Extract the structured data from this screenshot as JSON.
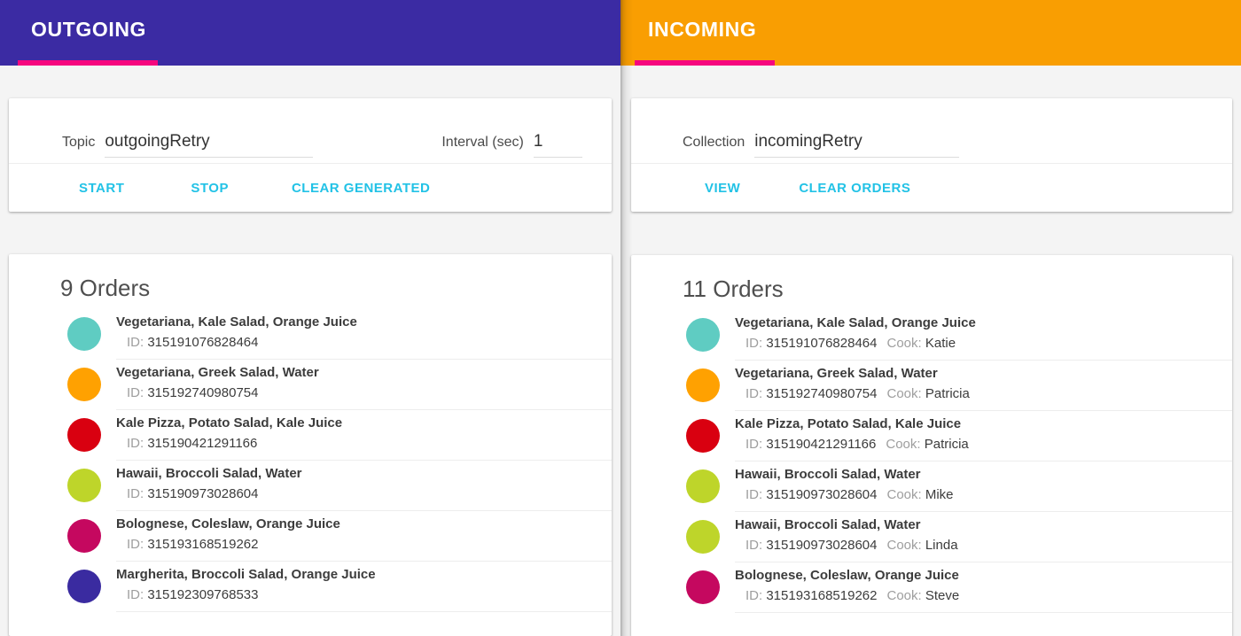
{
  "colors": {
    "outgoing_header": "#3b2ba3",
    "incoming_header": "#f99e02",
    "tab_underline": "#f6067e",
    "action_link": "#22c2e6",
    "page_background": "#f4f4f4",
    "card_background": "#ffffff"
  },
  "outgoing": {
    "toolbar_title": "OUTGOING",
    "form": {
      "topic_label": "Topic",
      "topic_value": "outgoingRetry",
      "topic_placeholder": "Topic",
      "interval_label": "Interval (sec)",
      "interval_value": "1",
      "interval_placeholder": "Interval"
    },
    "actions": {
      "start": "START",
      "stop": "STOP",
      "clear_generated": "CLEAR GENERATED"
    },
    "orders_title": "9 Orders",
    "orders": [
      {
        "color": "#5fccc2",
        "items": "Vegetariana, Kale Salad, Orange Juice",
        "id_label": "ID:",
        "id": "315191076828464"
      },
      {
        "color": "#ffa101",
        "items": "Vegetariana, Greek Salad, Water",
        "id_label": "ID:",
        "id": "315192740980754"
      },
      {
        "color": "#d90010",
        "items": "Kale Pizza, Potato Salad, Kale Juice",
        "id_label": "ID:",
        "id": "315190421291166"
      },
      {
        "color": "#bed52a",
        "items": "Hawaii, Broccoli Salad, Water",
        "id_label": "ID:",
        "id": "315190973028604"
      },
      {
        "color": "#c5085f",
        "items": "Bolognese, Coleslaw, Orange Juice",
        "id_label": "ID:",
        "id": "315193168519262"
      },
      {
        "color": "#3a2ba0",
        "items": "Margherita, Broccoli Salad, Orange Juice",
        "id_label": "ID:",
        "id": "315192309768533"
      }
    ]
  },
  "incoming": {
    "toolbar_title": "INCOMING",
    "form": {
      "collection_label": "Collection",
      "collection_value": "incomingRetry",
      "collection_placeholder": "Collection"
    },
    "actions": {
      "view": "VIEW",
      "clear_orders": "CLEAR ORDERS"
    },
    "orders_title": "11 Orders",
    "orders": [
      {
        "color": "#5fccc2",
        "items": "Vegetariana, Kale Salad, Orange Juice",
        "id_label": "ID:",
        "id": "315191076828464",
        "cook_label": "Cook:",
        "cook": "Katie"
      },
      {
        "color": "#ffa101",
        "items": "Vegetariana, Greek Salad, Water",
        "id_label": "ID:",
        "id": "315192740980754",
        "cook_label": "Cook:",
        "cook": "Patricia"
      },
      {
        "color": "#d90010",
        "items": "Kale Pizza, Potato Salad, Kale Juice",
        "id_label": "ID:",
        "id": "315190421291166",
        "cook_label": "Cook:",
        "cook": "Patricia"
      },
      {
        "color": "#bed52a",
        "items": "Hawaii, Broccoli Salad, Water",
        "id_label": "ID:",
        "id": "315190973028604",
        "cook_label": "Cook:",
        "cook": "Mike"
      },
      {
        "color": "#bed52a",
        "items": "Hawaii, Broccoli Salad, Water",
        "id_label": "ID:",
        "id": "315190973028604",
        "cook_label": "Cook:",
        "cook": "Linda"
      },
      {
        "color": "#c5085f",
        "items": "Bolognese, Coleslaw, Orange Juice",
        "id_label": "ID:",
        "id": "315193168519262",
        "cook_label": "Cook:",
        "cook": "Steve"
      }
    ]
  }
}
